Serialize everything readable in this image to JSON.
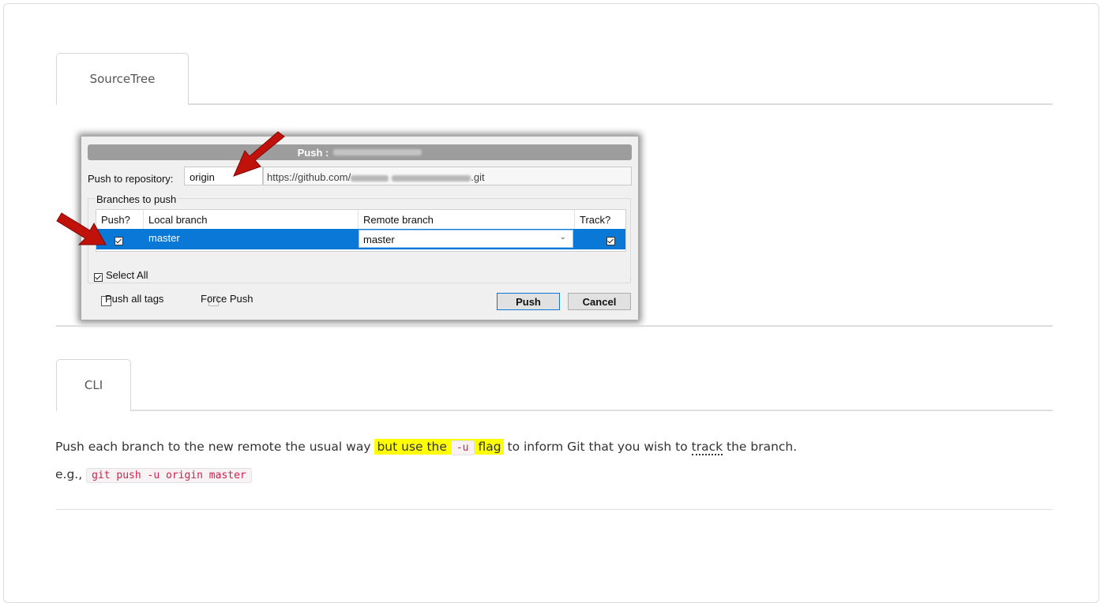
{
  "tabs": [
    {
      "label": "SourceTree"
    },
    {
      "label": "CLI"
    }
  ],
  "dialog": {
    "title": "Push :",
    "push_to_label": "Push to repository:",
    "remote_value": "origin",
    "url_prefix": "https://github.com/",
    "url_suffix": ".git",
    "branches_group_label": "Branches to push",
    "columns": [
      "Push?",
      "Local branch",
      "Remote branch",
      "Track?"
    ],
    "row": {
      "local_branch": "master",
      "remote_branch": "master",
      "push_checked": true,
      "track_checked": true
    },
    "select_all_label": "Select All",
    "push_all_tags_label": "Push all tags",
    "force_push_label": "Force Push",
    "push_button": "Push",
    "cancel_button": "Cancel"
  },
  "cli": {
    "line1_start": "Push each branch to the new remote the usual way",
    "line1_hl_start": "but use the",
    "flag_code": "-u",
    "line1_hl_end": "flag",
    "line1_mid": "to inform Git that you wish to",
    "track_word": "track",
    "line1_end": "the branch.",
    "eg_label": "e.g.,",
    "command_code": "git push -u origin master"
  },
  "colors": {
    "highlight": "#ffff00",
    "selection_blue": "#0a78d7",
    "code_text": "#c7254e",
    "arrow_red": "#c1110b"
  }
}
